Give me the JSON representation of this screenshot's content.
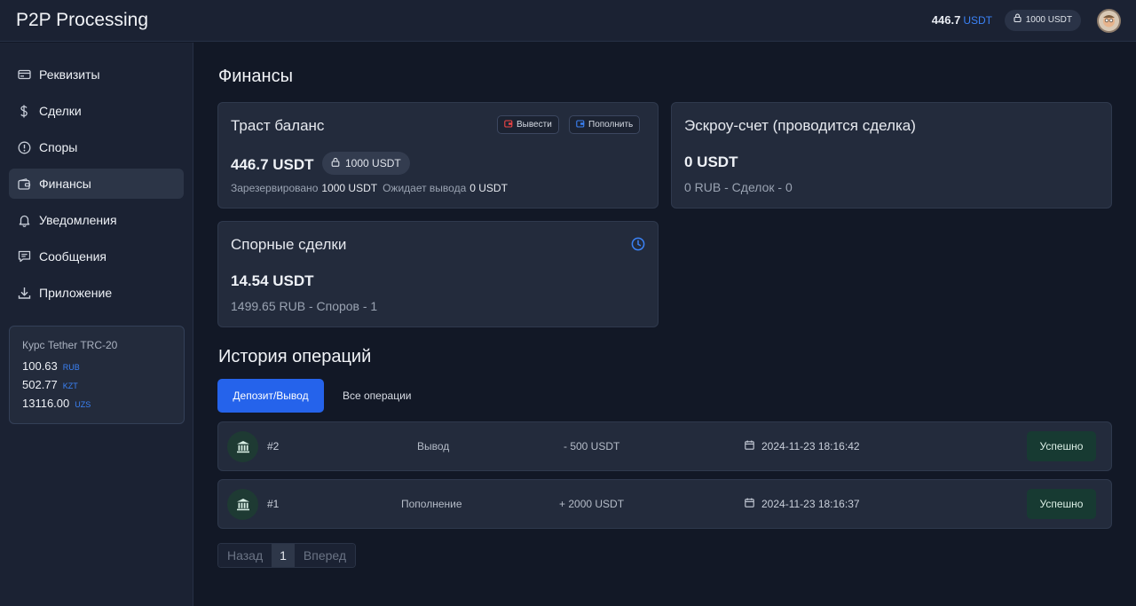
{
  "app": {
    "title": "P2P Processing"
  },
  "header": {
    "balance_value": "446.7",
    "balance_unit": "USDT",
    "locked_label": "1000 USDT"
  },
  "sidebar": {
    "items": [
      {
        "label": "Реквизиты",
        "icon": "card-icon",
        "active": false
      },
      {
        "label": "Сделки",
        "icon": "dollar-icon",
        "active": false
      },
      {
        "label": "Споры",
        "icon": "alert-circle-icon",
        "active": false
      },
      {
        "label": "Финансы",
        "icon": "wallet-icon",
        "active": true
      },
      {
        "label": "Уведомления",
        "icon": "bell-icon",
        "active": false
      },
      {
        "label": "Сообщения",
        "icon": "message-icon",
        "active": false
      },
      {
        "label": "Приложение",
        "icon": "download-icon",
        "active": false
      }
    ],
    "rates": {
      "title": "Курс Tether TRC-20",
      "rows": [
        {
          "value": "100.63",
          "currency": "RUB"
        },
        {
          "value": "502.77",
          "currency": "KZT"
        },
        {
          "value": "13116.00",
          "currency": "UZS"
        }
      ]
    }
  },
  "main": {
    "title": "Финансы",
    "trust": {
      "title": "Траст баланс",
      "withdraw_label": "Вывести",
      "deposit_label": "Пополнить",
      "amount": "446.7 USDT",
      "locked": "1000 USDT",
      "reserved_label": "Зарезервировано",
      "reserved_value": "1000 USDT",
      "pending_label": "Ожидает вывода",
      "pending_value": "0 USDT"
    },
    "escrow": {
      "title": "Эскроу-счет (проводится сделка)",
      "amount": "0 USDT",
      "sub": "0 RUB - Сделок - 0"
    },
    "disputes": {
      "title": "Спорные сделки",
      "amount": "14.54 USDT",
      "sub": "1499.65 RUB - Споров - 1"
    },
    "history": {
      "title": "История операций",
      "tabs": [
        "Депозит/Вывод",
        "Все операции"
      ],
      "rows": [
        {
          "id": "#2",
          "type": "Вывод",
          "amount": "- 500 USDT",
          "date": "2024-11-23 18:16:42",
          "status": "Успешно"
        },
        {
          "id": "#1",
          "type": "Пополнение",
          "amount": "+ 2000 USDT",
          "date": "2024-11-23 18:16:37",
          "status": "Успешно"
        }
      ]
    },
    "pagination": {
      "prev": "Назад",
      "current": "1",
      "next": "Вперед"
    }
  },
  "colors": {
    "accent": "#2563eb",
    "success_bg": "#173a32",
    "bg": "#121826",
    "panel": "#232b3c"
  }
}
